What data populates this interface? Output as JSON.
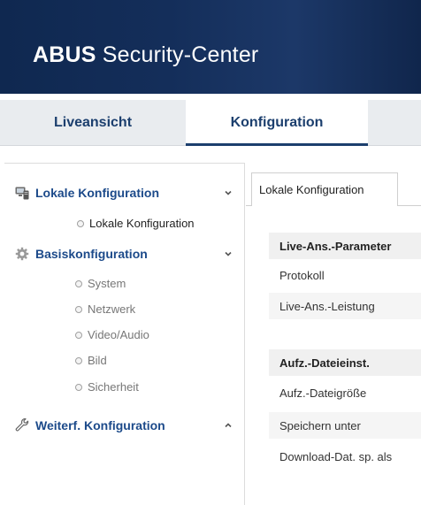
{
  "header": {
    "brand_bold": "ABUS",
    "brand_rest": " Security-Center",
    "background_color": "#142e5a"
  },
  "topnav": {
    "tabs": [
      {
        "label": "Liveansicht",
        "active": false
      },
      {
        "label": "Konfiguration",
        "active": true
      }
    ],
    "accent_color": "#1c3f6e"
  },
  "sidebar": {
    "sections": [
      {
        "label": "Lokale Konfiguration",
        "icon": "computer-icon",
        "expanded": true,
        "items": [
          {
            "label": "Lokale Konfiguration",
            "active": true
          }
        ]
      },
      {
        "label": "Basiskonfiguration",
        "icon": "gear-icon",
        "expanded": true,
        "items": [
          {
            "label": "System",
            "active": false
          },
          {
            "label": "Netzwerk",
            "active": false
          },
          {
            "label": "Video/Audio",
            "active": false
          },
          {
            "label": "Bild",
            "active": false
          },
          {
            "label": "Sicherheit",
            "active": false
          }
        ]
      },
      {
        "label": "Weiterf. Konfiguration",
        "icon": "wrench-icon",
        "expanded": false,
        "items": []
      }
    ]
  },
  "content": {
    "tab_label": "Lokale Konfiguration",
    "groups": [
      {
        "title": "Live-Ans.-Parameter",
        "rows": [
          "Protokoll",
          "Live-Ans.-Leistung"
        ]
      },
      {
        "title": "Aufz.-Dateieinst.",
        "rows": [
          "Aufz.-Dateigröße",
          "Speichern unter",
          "Download-Dat. sp. als"
        ]
      }
    ]
  }
}
